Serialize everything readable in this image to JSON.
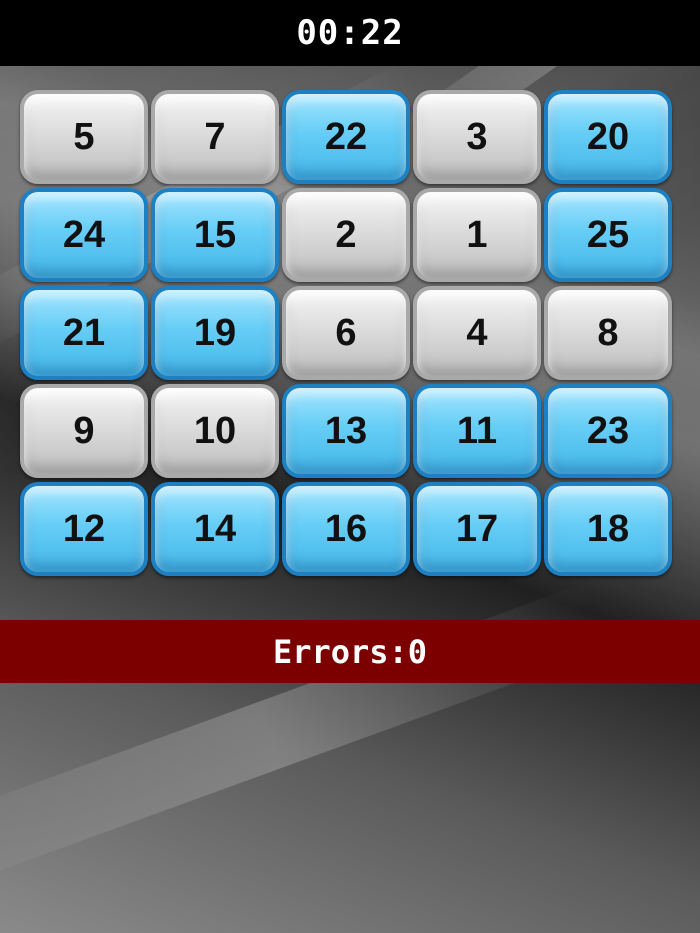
{
  "header": {
    "timer": "00:22"
  },
  "board": {
    "tiles": [
      {
        "label": "5",
        "state": "gray"
      },
      {
        "label": "7",
        "state": "gray"
      },
      {
        "label": "22",
        "state": "blue"
      },
      {
        "label": "3",
        "state": "gray"
      },
      {
        "label": "20",
        "state": "blue"
      },
      {
        "label": "24",
        "state": "blue"
      },
      {
        "label": "15",
        "state": "blue"
      },
      {
        "label": "2",
        "state": "gray"
      },
      {
        "label": "1",
        "state": "gray"
      },
      {
        "label": "25",
        "state": "blue"
      },
      {
        "label": "21",
        "state": "blue"
      },
      {
        "label": "19",
        "state": "blue"
      },
      {
        "label": "6",
        "state": "gray"
      },
      {
        "label": "4",
        "state": "gray"
      },
      {
        "label": "8",
        "state": "gray"
      },
      {
        "label": "9",
        "state": "gray"
      },
      {
        "label": "10",
        "state": "gray"
      },
      {
        "label": "13",
        "state": "blue"
      },
      {
        "label": "11",
        "state": "blue"
      },
      {
        "label": "23",
        "state": "blue"
      },
      {
        "label": "12",
        "state": "blue"
      },
      {
        "label": "14",
        "state": "blue"
      },
      {
        "label": "16",
        "state": "blue"
      },
      {
        "label": "17",
        "state": "blue"
      },
      {
        "label": "18",
        "state": "blue"
      }
    ]
  },
  "status": {
    "errors": "Errors:0"
  },
  "colors": {
    "header_bg": "#000000",
    "errors_bg": "#7c0000",
    "tile_gray": "#d8d8d8",
    "tile_blue": "#66cdf6"
  }
}
